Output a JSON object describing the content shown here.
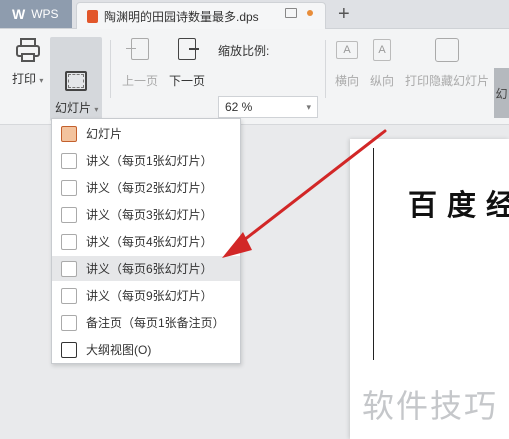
{
  "tabs": {
    "app": "WPS",
    "document": "陶渊明的田园诗数量最多.dps"
  },
  "toolbar": {
    "print": "打印",
    "slides": "幻灯片",
    "prev_page": "上一页",
    "next_page": "下一页",
    "zoom_label": "缩放比例:",
    "zoom_value": "62 %",
    "landscape": "横向",
    "portrait": "纵向",
    "print_hidden": "打印隐藏幻灯片",
    "rightmost": "幻"
  },
  "dropdown": {
    "items": [
      {
        "label": "幻灯片"
      },
      {
        "label": "讲义（每页1张幻灯片）"
      },
      {
        "label": "讲义（每页2张幻灯片）"
      },
      {
        "label": "讲义（每页3张幻灯片）"
      },
      {
        "label": "讲义（每页4张幻灯片）"
      },
      {
        "label": "讲义（每页6张幻灯片）"
      },
      {
        "label": "讲义（每页9张幻灯片）"
      },
      {
        "label": "备注页（每页1张备注页）"
      },
      {
        "label": "大纲视图(O)"
      }
    ],
    "highlighted_index": 5
  },
  "watermark": {
    "top": "百度经",
    "bottom": "软件技巧"
  },
  "colors": {
    "accent": "#e2572b",
    "arrow": "#d22727",
    "highlight": "#e6e7e9"
  }
}
